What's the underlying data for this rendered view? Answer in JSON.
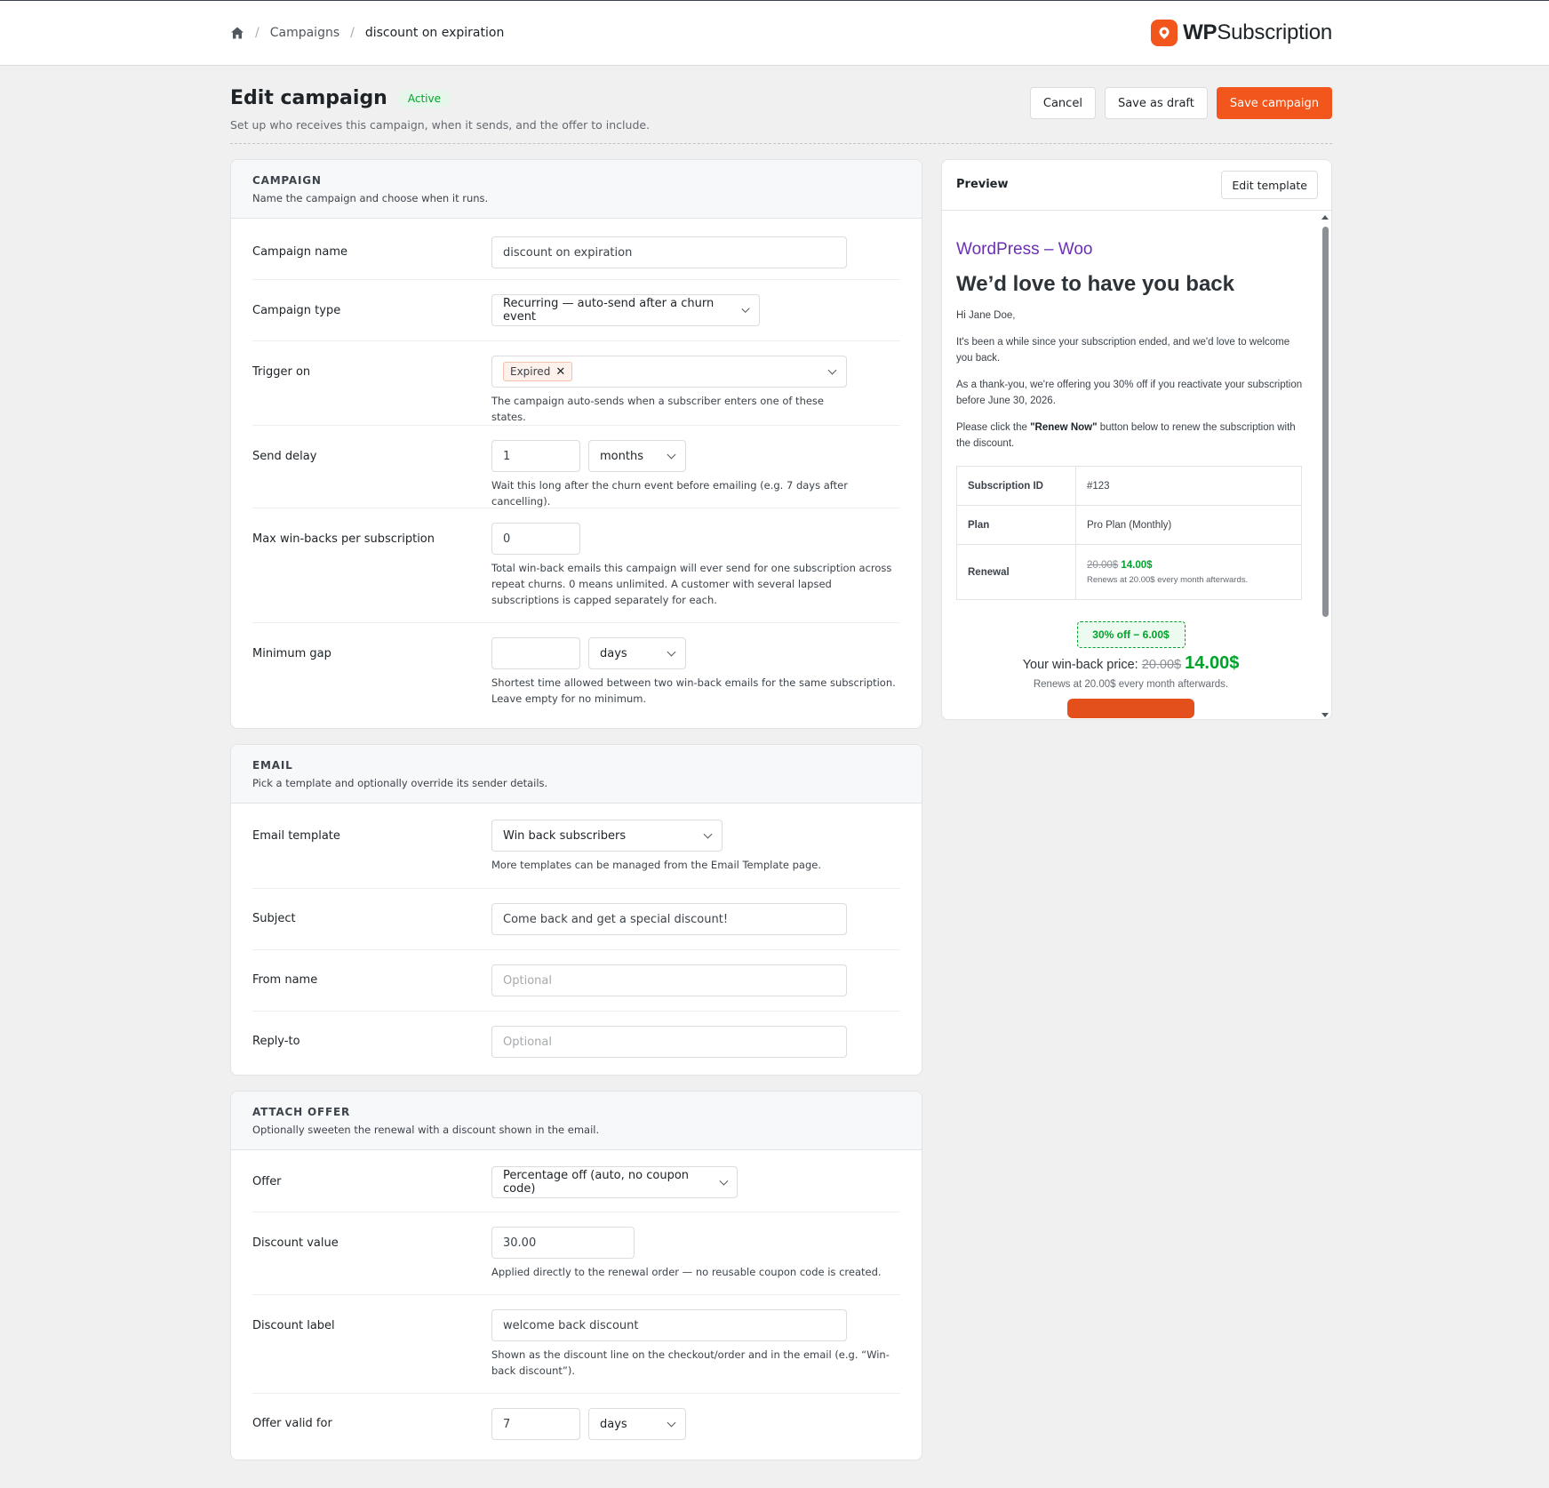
{
  "breadcrumb": {
    "home_icon": "home-icon",
    "items": [
      "Campaigns",
      "discount on expiration"
    ],
    "separator": "/"
  },
  "brand": {
    "name_bold": "WP",
    "name_rest": "Subscription",
    "color": "#f2561d"
  },
  "header": {
    "title": "Edit campaign",
    "status": "Active",
    "subtitle": "Set up who receives this campaign, when it sends, and the offer to include.",
    "cancel": "Cancel",
    "save_draft": "Save as draft",
    "save": "Save campaign"
  },
  "campaign": {
    "heading": "CAMPAIGN",
    "desc": "Name the campaign and choose when it runs.",
    "name_label": "Campaign name",
    "name_value": "discount on expiration",
    "type_label": "Campaign type",
    "type_value": "Recurring — auto-send after a churn event",
    "trigger_label": "Trigger on",
    "trigger_chip": "Expired",
    "trigger_help": "The campaign auto-sends when a subscriber enters one of these states.",
    "delay_label": "Send delay",
    "delay_value": "1",
    "delay_unit": "months",
    "delay_help": "Wait this long after the churn event before emailing (e.g. 7 days after cancelling).",
    "max_label": "Max win-backs per subscription",
    "max_value": "0",
    "max_help": "Total win-back emails this campaign will ever send for one subscription across repeat churns. 0 means unlimited. A customer with several lapsed subscriptions is capped separately for each.",
    "gap_label": "Minimum gap",
    "gap_value": "",
    "gap_unit": "days",
    "gap_help": "Shortest time allowed between two win-back emails for the same subscription. Leave empty for no minimum."
  },
  "email": {
    "heading": "EMAIL",
    "desc": "Pick a template and optionally override its sender details.",
    "template_label": "Email template",
    "template_value": "Win back subscribers",
    "template_help": "More templates can be managed from the Email Template page.",
    "subject_label": "Subject",
    "subject_value": "Come back and get a special discount!",
    "from_label": "From name",
    "from_placeholder": "Optional",
    "reply_label": "Reply-to",
    "reply_placeholder": "Optional"
  },
  "offer": {
    "heading": "ATTACH OFFER",
    "desc": "Optionally sweeten the renewal with a discount shown in the email.",
    "offer_label": "Offer",
    "offer_value": "Percentage off (auto, no coupon code)",
    "value_label": "Discount value",
    "value_value": "30.00",
    "value_help": "Applied directly to the renewal order — no reusable coupon code is created.",
    "dlabel_label": "Discount label",
    "dlabel_value": "welcome back discount",
    "dlabel_help": "Shown as the discount line on the checkout/order and in the email (e.g. “Win-back discount”).",
    "valid_label": "Offer valid for",
    "valid_value": "7",
    "valid_unit": "days"
  },
  "preview": {
    "title": "Preview",
    "edit": "Edit template",
    "store": "WordPress – Woo",
    "headline": "We’d love to have you back",
    "greeting": "Hi Jane Doe,",
    "p1": "It's been a while since your subscription ended, and we'd love to welcome you back.",
    "p2": "As a thank-you, we're offering you 30% off if you reactivate your subscription before June 30, 2026.",
    "p3_pre": "Please click the ",
    "p3_bold": "\"Renew Now\"",
    "p3_post": " button below to renew the subscription with the discount.",
    "rows": [
      {
        "k": "Subscription ID",
        "v": "#123"
      },
      {
        "k": "Plan",
        "v": "Pro Plan (Monthly)"
      }
    ],
    "renewal_label": "Renewal",
    "renewal_old": "20.00$",
    "renewal_new": "14.00$",
    "renewal_note": "Renews at 20.00$ every month afterwards.",
    "badge": "30% off − 6.00$",
    "win_label": "Your win-back price:",
    "win_old": "20.00$",
    "win_new": "14.00$",
    "win_note": "Renews at 20.00$ every month afterwards."
  }
}
